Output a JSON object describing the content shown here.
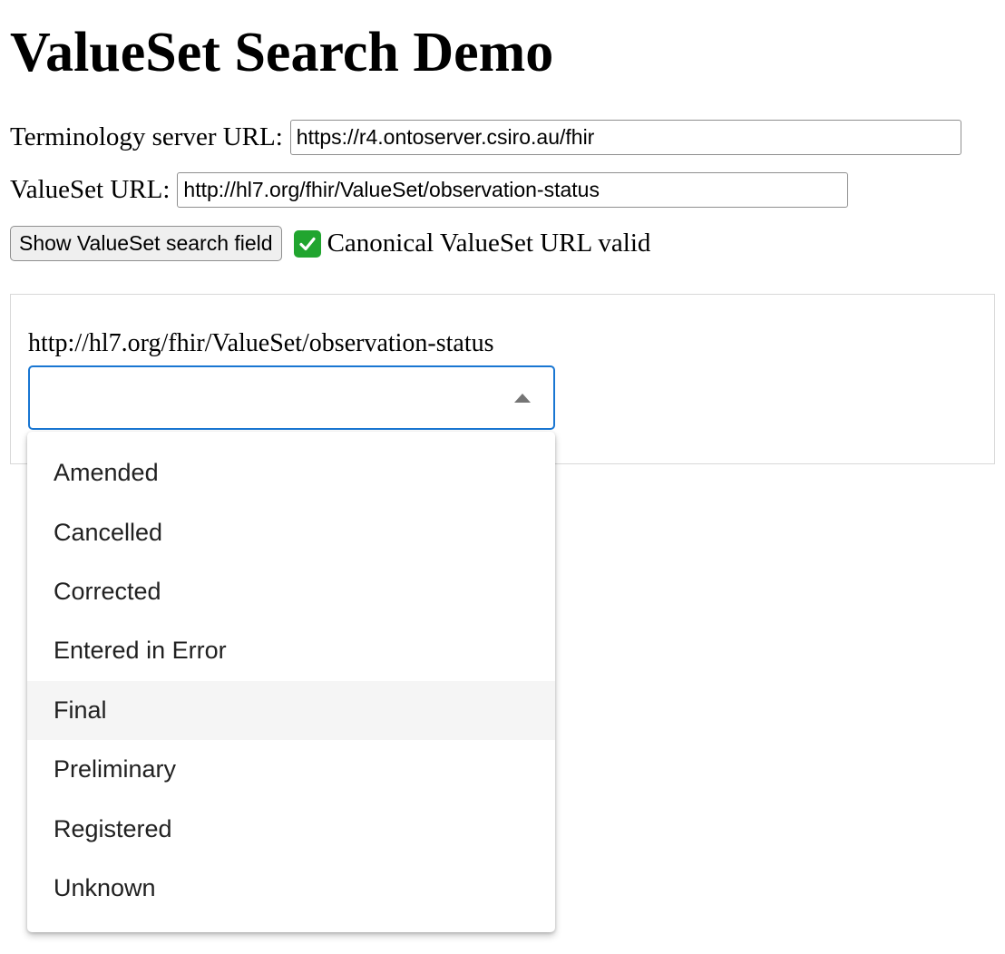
{
  "page": {
    "title": "ValueSet Search Demo"
  },
  "form": {
    "server_label": "Terminology server URL:",
    "server_value": "https://r4.ontoserver.csiro.au/fhir",
    "valueset_label": "ValueSet URL:",
    "valueset_value": "http://hl7.org/fhir/ValueSet/observation-status",
    "show_button_label": "Show ValueSet search field",
    "status_icon": "check-mark-icon",
    "status_text": "Canonical ValueSet URL valid",
    "status_color": "#21a52f"
  },
  "search": {
    "valueset_label": "http://hl7.org/fhir/ValueSet/observation-status",
    "input_value": "",
    "accent_color": "#1976d2",
    "expanded": true,
    "options": [
      {
        "label": "Amended"
      },
      {
        "label": "Cancelled"
      },
      {
        "label": "Corrected"
      },
      {
        "label": "Entered in Error"
      },
      {
        "label": "Final",
        "highlighted": true
      },
      {
        "label": "Preliminary"
      },
      {
        "label": "Registered"
      },
      {
        "label": "Unknown"
      }
    ]
  }
}
